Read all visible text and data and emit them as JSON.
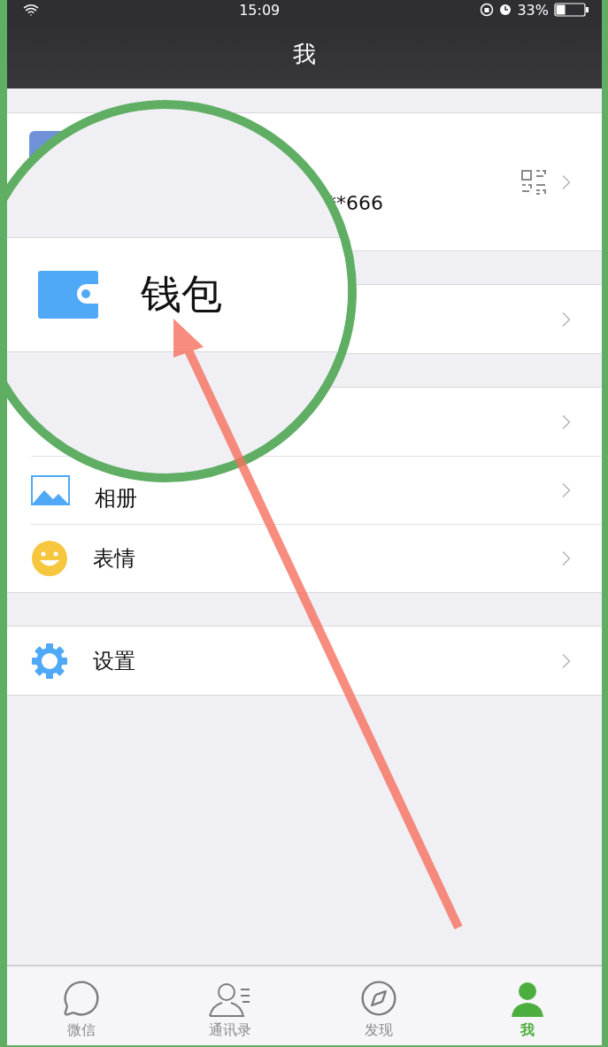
{
  "status_bar": {
    "time": "15:09",
    "battery": "33%"
  },
  "nav": {
    "title": "我"
  },
  "profile": {
    "id_visible": "**666"
  },
  "groups": [
    {
      "rows": [
        {
          "kind": "covered"
        }
      ]
    },
    {
      "rows": [
        {
          "kind": "covered"
        },
        {
          "kind": "album",
          "label": "相册"
        },
        {
          "kind": "emoji",
          "label": "表情"
        }
      ]
    },
    {
      "rows": [
        {
          "kind": "settings",
          "label": "设置"
        }
      ]
    }
  ],
  "magnifier": {
    "label": "钱包"
  },
  "tabs": [
    {
      "kind": "chat",
      "label": "微信",
      "selected": false
    },
    {
      "kind": "contacts",
      "label": "通讯录",
      "selected": false
    },
    {
      "kind": "discover",
      "label": "发现",
      "selected": false
    },
    {
      "kind": "me",
      "label": "我",
      "selected": true
    }
  ]
}
